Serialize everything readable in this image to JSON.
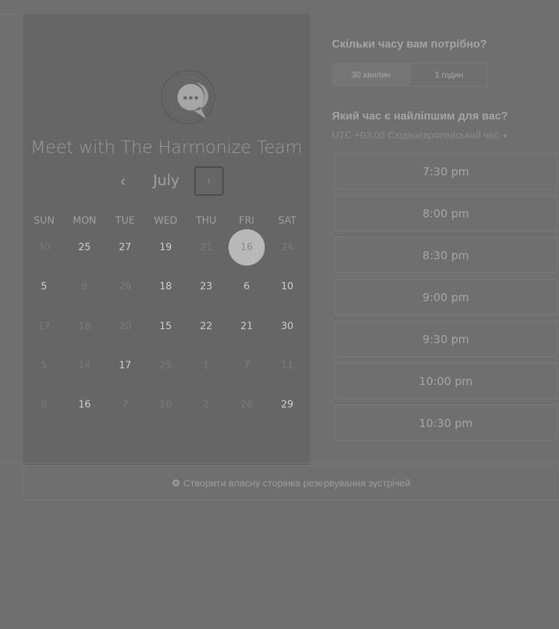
{
  "left": {
    "title": "Meet with The Harmonize Team",
    "month": "July",
    "weekdays": [
      "SUN",
      "MON",
      "TUE",
      "WED",
      "THU",
      "FRI",
      "SAT"
    ],
    "weeks": [
      [
        {
          "day": "30",
          "enabled": false
        },
        {
          "day": "25",
          "enabled": true
        },
        {
          "day": "27",
          "enabled": true
        },
        {
          "day": "19",
          "enabled": true
        },
        {
          "day": "21",
          "enabled": false
        },
        {
          "day": "16",
          "enabled": true,
          "selected": true
        },
        {
          "day": "24",
          "enabled": false
        }
      ],
      [
        {
          "day": "5",
          "enabled": true
        },
        {
          "day": "9",
          "enabled": false
        },
        {
          "day": "26",
          "enabled": false
        },
        {
          "day": "18",
          "enabled": true
        },
        {
          "day": "23",
          "enabled": true
        },
        {
          "day": "6",
          "enabled": true
        },
        {
          "day": "10",
          "enabled": true
        }
      ],
      [
        {
          "day": "17",
          "enabled": false
        },
        {
          "day": "18",
          "enabled": false
        },
        {
          "day": "20",
          "enabled": false
        },
        {
          "day": "15",
          "enabled": true
        },
        {
          "day": "22",
          "enabled": true
        },
        {
          "day": "21",
          "enabled": true
        },
        {
          "day": "30",
          "enabled": true
        }
      ],
      [
        {
          "day": "5",
          "enabled": false
        },
        {
          "day": "14",
          "enabled": false
        },
        {
          "day": "17",
          "enabled": true
        },
        {
          "day": "25",
          "enabled": false
        },
        {
          "day": "1",
          "enabled": false
        },
        {
          "day": "7",
          "enabled": false
        },
        {
          "day": "11",
          "enabled": false
        }
      ],
      [
        {
          "day": "9",
          "enabled": false
        },
        {
          "day": "16",
          "enabled": true
        },
        {
          "day": "7",
          "enabled": false
        },
        {
          "day": "16",
          "enabled": false
        },
        {
          "day": "2",
          "enabled": false
        },
        {
          "day": "26",
          "enabled": false
        },
        {
          "day": "29",
          "enabled": true
        }
      ]
    ]
  },
  "right": {
    "duration_question": "Скільки часу вам потрібно?",
    "duration_options": [
      "30 хвилин",
      "1 годин"
    ],
    "time_question": "Який час є найліпшим для вас?",
    "timezone": "UTC +03:00 Східноєвропейський час",
    "slots": [
      "7:30 pm",
      "8:00 pm",
      "8:30 pm",
      "9:00 pm",
      "9:30 pm",
      "10:00 pm",
      "10:30 pm"
    ]
  },
  "footer": {
    "cta": "Створити власну сторінка резервування зустрічей"
  }
}
